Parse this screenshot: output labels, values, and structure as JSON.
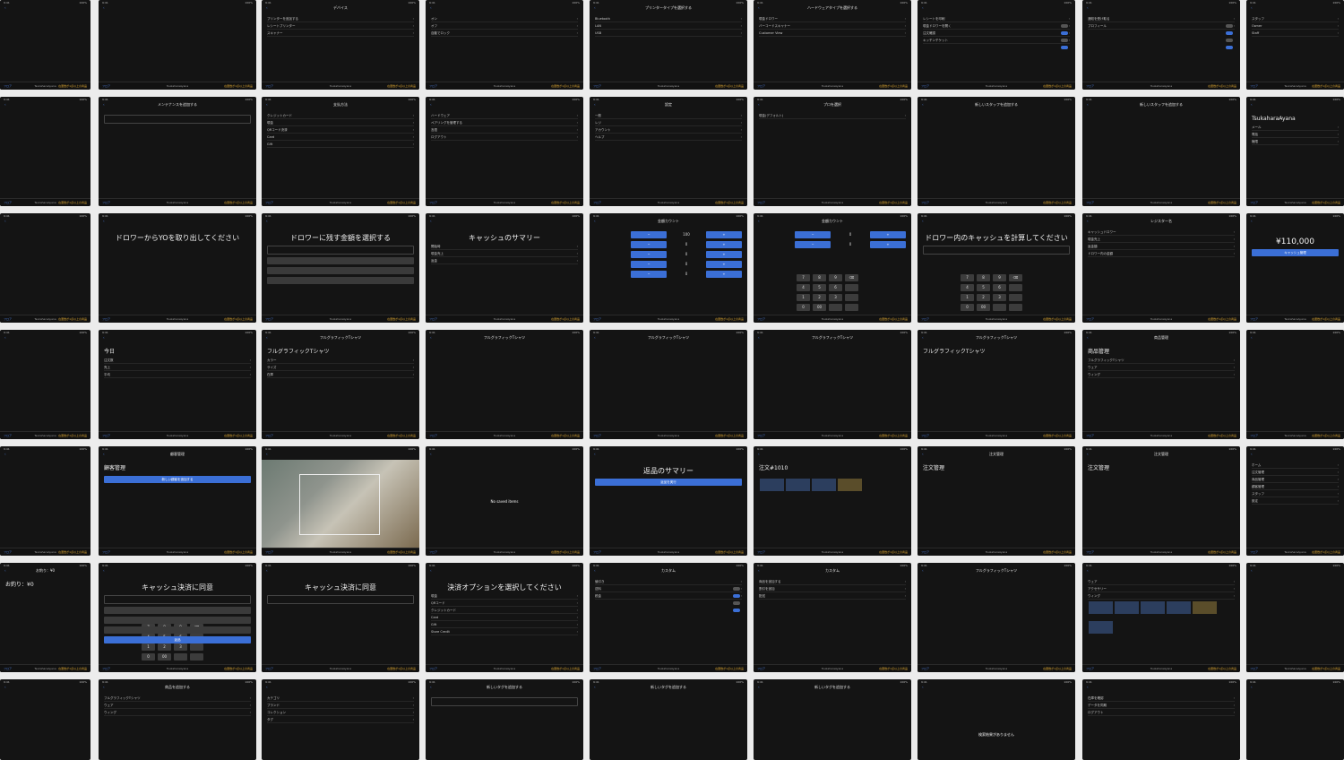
{
  "status": {
    "time": "9:41",
    "battery": "100%"
  },
  "tabbar": {
    "left": "フロア",
    "center": "TsukaharaAyana",
    "right": "在庫数が1点以上の商品"
  },
  "screens": {
    "r0c2": {
      "title": "デバイス",
      "rows": [
        "プリンターを追加する",
        "レシートプリンター",
        "スキャナー"
      ]
    },
    "r0c3": {
      "rows": [
        "オン",
        "オフ",
        "自動でロック"
      ]
    },
    "r0c4": {
      "title": "プリンタータイプを選択する",
      "rows": [
        "Bluetooth",
        "LAN",
        "USB"
      ]
    },
    "r0c5": {
      "title": "ハードウェアタイプを選択する",
      "rows": [
        "現金ドロワー",
        "バーコードスキャナー",
        "Customer View"
      ]
    },
    "r0c6": {
      "rows": [
        "レシートを印刷",
        "現金ドロワーを開く",
        "注文確認",
        "キッチンチケット"
      ]
    },
    "r0c7": {
      "rows": [
        "通知を受け取る",
        "プロフィール"
      ]
    },
    "r0c8": {
      "rows": [
        "スタッフ",
        "Owner",
        "Staff"
      ]
    },
    "r1c1": {
      "title": "メンテナンスを追加する"
    },
    "r1c2": {
      "title": "支払方法",
      "rows": [
        "クレジットカード",
        "現金",
        "QRコード決済",
        "Card",
        "Gift"
      ]
    },
    "r1c3": {
      "rows": [
        "ハードウェア",
        "ペアリングを管理する",
        "言語",
        "ログアウト"
      ]
    },
    "r1c4": {
      "title": "設定",
      "rows": [
        "一般",
        "レジ",
        "アカウント",
        "ヘルプ"
      ]
    },
    "r1c5": {
      "title": "プロを選択",
      "rows": [
        "現金(デフォルト)"
      ]
    },
    "r1c6": {
      "title": "新しいスタッフを追加する"
    },
    "r1c7": {
      "title": "新しいスタッフを追加する"
    },
    "r1c8": {
      "name": "TsukaharaAyana",
      "rows": [
        "メール",
        "電話",
        "権限"
      ]
    },
    "r1c9": {
      "title": "スタッフ",
      "button": "スタッフを追加する"
    },
    "r2c1": {
      "title": "ドロワーからYOを取り出してください"
    },
    "r2c2": {
      "title": "ドロワーに残す金額を選択する"
    },
    "r2c3": {
      "title": "キャッシュのサマリー",
      "rows": [
        "開始時",
        "現金売上",
        "返金"
      ]
    },
    "r2c4": {
      "title": "金額カウント",
      "amount": "100"
    },
    "r2c5": {
      "title": "金額カウント"
    },
    "r2c6": {
      "title": "ドロワー内のキャッシュを計算してください"
    },
    "r2c7": {
      "title": "レジスター名",
      "rows": [
        "キャッシュドロワー",
        "現金売上",
        "返金額",
        "ドロワー内の金額"
      ]
    },
    "r2c8": {
      "amount": "¥110,000",
      "button": "キャッシュ管理"
    },
    "r3c1": {
      "title": "今日",
      "rows": [
        "注文数",
        "売上",
        "平均"
      ]
    },
    "r3c2": {
      "title": "フルグラフィックTシャツ",
      "rows": [
        "カラー",
        "サイズ",
        "在庫"
      ]
    },
    "r3c3": {
      "title": "フルグラフィックTシャツ"
    },
    "r3c4": {
      "title": "フルグラフィックTシャツ"
    },
    "r3c5": {
      "title": "フルグラフィックTシャツ"
    },
    "r3c6": {
      "title": "フルグラフィックTシャツ"
    },
    "r3c7": {
      "title": "商品管理",
      "rows": [
        "フルグラフィックTシャツ",
        "ウェア",
        "ウィング"
      ]
    },
    "r4c1": {
      "title": "顧客管理",
      "button": "新しい顧客を追加する"
    },
    "r4c3": {
      "message": "No saved items"
    },
    "r4c4": {
      "title": "返品のサマリー",
      "button": "返品を実行"
    },
    "r4c5": {
      "order": "注文#1010"
    },
    "r4c6": {
      "title": "注文管理"
    },
    "r4c7": {
      "title": "注文管理"
    },
    "r4c8": {
      "rows": [
        "ホーム",
        "注文管理",
        "商品管理",
        "顧客管理",
        "スタッフ",
        "設定"
      ]
    },
    "r5c0": {
      "title": "お釣り：¥0"
    },
    "r5c1": {
      "title": "キャッシュ決済に同意",
      "button": "返品"
    },
    "r5c2": {
      "title": "キャッシュ決済に同意"
    },
    "r5c3": {
      "title": "決済オプションを選択してください",
      "rows": [
        "現金",
        "QRコード",
        "クレジットカード",
        "Card",
        "Gift",
        "Store Credit"
      ]
    },
    "r5c4": {
      "title": "カスタム",
      "rows": [
        "値引き",
        "送料",
        "税金"
      ]
    },
    "r5c5": {
      "title": "カスタム",
      "rows": [
        "商品を追加する",
        "割引を追加",
        "配送"
      ]
    },
    "r5c6": {
      "title": "フルグラフィックTシャツ",
      "qty": "1"
    },
    "r5c7": {
      "rows": [
        "ウェア",
        "アクセサリー",
        "ウィング"
      ]
    },
    "r6c1": {
      "title": "商品を追加する",
      "rows": [
        "フルグラフィックTシャツ",
        "ウェア",
        "ウィング"
      ]
    },
    "r6c2": {
      "rows": [
        "カテゴリ",
        "ブランド",
        "コレクション",
        "タグ"
      ]
    },
    "r6c3": {
      "title": "新しいタグを追加する"
    },
    "r6c4": {
      "title": "新しいタグを追加する"
    },
    "r6c5": {
      "title": "新しいタグを追加する"
    },
    "r6c6": {
      "message": "検索結果がありません"
    },
    "r6c7": {
      "rows": [
        "在庫を確認",
        "データを同期",
        "ログアウト"
      ]
    }
  }
}
